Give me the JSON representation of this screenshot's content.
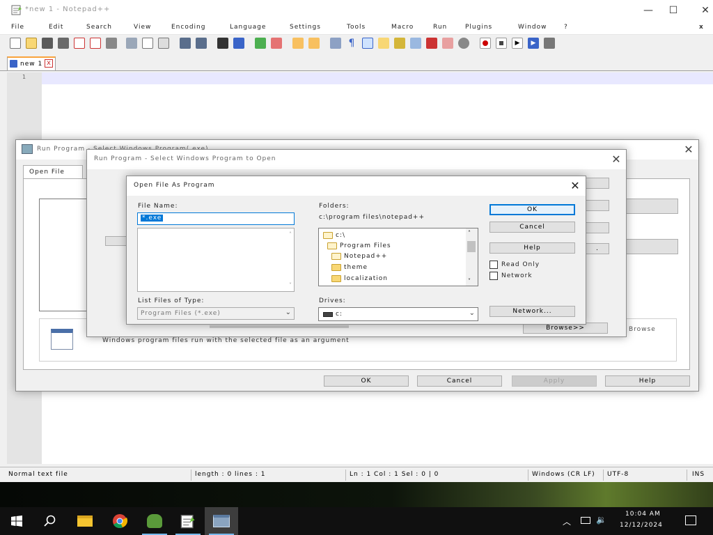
{
  "window": {
    "title": "*new 1 - Notepad++",
    "min": "—",
    "max": "☐",
    "close": "✕"
  },
  "menu": [
    "File",
    "Edit",
    "Search",
    "View",
    "Encoding",
    "Language",
    "Settings",
    "Tools",
    "Macro",
    "Run",
    "Plugins",
    "Window",
    "?"
  ],
  "tab": {
    "label": "new 1",
    "close": "x"
  },
  "editor": {
    "line": "1"
  },
  "status": {
    "type": "Normal text file",
    "length": "length : 0    lines : 1",
    "pos": "Ln : 1    Col : 1    Sel : 0 | 0",
    "eol": "Windows (CR LF)",
    "enc": "UTF-8",
    "ins": "INS"
  },
  "back_dialog": {
    "title": "Run Program - Select Windows Program(.exe)",
    "tab": "Open File",
    "close": "✕",
    "ok": "OK",
    "cancel": "Cancel",
    "apply": "Apply",
    "help": "Help",
    "dots": ".",
    "note": "Windows program files run with the selected file as an argument"
  },
  "mid_dialog": {
    "title": "Run Program - Select Windows Program to Open",
    "close": "✕",
    "browse": "Browse>>",
    "tail": "Browse"
  },
  "front_dialog": {
    "title": "Open File As Program",
    "file_name_label": "File Name:",
    "file_name_value": "*.exe",
    "folders_label": "Folders:",
    "folders_path": "c:\\program files\\notepad++",
    "tree": [
      "c:\\",
      "Program Files",
      "Notepad++",
      "theme",
      "localization"
    ],
    "types_label": "List Files of Type:",
    "types_value": "Program Files (*.exe)",
    "drives_label": "Drives:",
    "drives_value": "c:",
    "ok": "OK",
    "cancel": "Cancel",
    "help": "Help",
    "read_only": "Read Only",
    "network": "Network",
    "network_btn": "Network...",
    "close": "✕"
  },
  "taskbar": {
    "time": "10:04 AM",
    "date": "12/12/2024"
  },
  "colors": {
    "accent": "#0078d7",
    "tab_accent": "#f9a33c",
    "taskbar": "#101010"
  }
}
